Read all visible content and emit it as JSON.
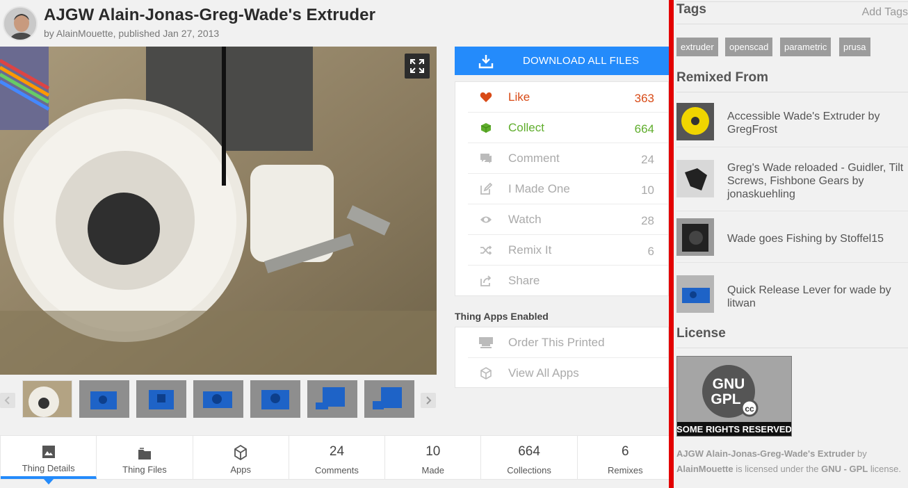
{
  "header": {
    "title": "AJGW Alain-Jonas-Greg-Wade's Extruder",
    "byline": "by AlainMouette, published Jan 27, 2013"
  },
  "download": {
    "label": "DOWNLOAD ALL FILES"
  },
  "actions": [
    {
      "label": "Like",
      "count": "363",
      "icon": "heart-icon",
      "color": "#d84a16"
    },
    {
      "label": "Collect",
      "count": "664",
      "icon": "cube-icon",
      "color": "#5fad2c"
    },
    {
      "label": "Comment",
      "count": "24",
      "icon": "comment-icon"
    },
    {
      "label": "I Made One",
      "count": "10",
      "icon": "pencil-icon"
    },
    {
      "label": "Watch",
      "count": "28",
      "icon": "eye-icon"
    },
    {
      "label": "Remix It",
      "count": "6",
      "icon": "shuffle-icon"
    },
    {
      "label": "Share",
      "count": "",
      "icon": "share-icon"
    }
  ],
  "apps": {
    "heading": "Thing Apps Enabled",
    "items": [
      {
        "label": "Order This Printed",
        "icon": "printer-icon"
      },
      {
        "label": "View All Apps",
        "icon": "box-icon"
      }
    ]
  },
  "tabs": [
    {
      "label": "Thing Details",
      "number": "",
      "icon": "details-icon"
    },
    {
      "label": "Thing Files",
      "number": "",
      "icon": "folder-icon"
    },
    {
      "label": "Apps",
      "number": "",
      "icon": "box-icon"
    },
    {
      "label": "Comments",
      "number": "24"
    },
    {
      "label": "Made",
      "number": "10"
    },
    {
      "label": "Collections",
      "number": "664"
    },
    {
      "label": "Remixes",
      "number": "6"
    }
  ],
  "right": {
    "tags_heading": "Tags",
    "add_tags": "Add Tags",
    "tags": [
      "extruder",
      "openscad",
      "parametric",
      "prusa"
    ],
    "remixed_heading": "Remixed From",
    "remixes": [
      {
        "text": "Accessible Wade's Extruder by GregFrost"
      },
      {
        "text": "Greg's Wade reloaded - Guidler, Tilt Screws, Fishbone Gears by jonaskuehling"
      },
      {
        "text": "Wade goes Fishing by Stoffel15"
      },
      {
        "text": "Quick Release Lever for wade by litwan"
      }
    ],
    "license_heading": "License",
    "license_badge": {
      "line1": "GNU",
      "line2": "GPL",
      "cc": "cc",
      "footer": "SOME RIGHTS RESERVED"
    },
    "license_text": {
      "thing": "AJGW Alain-Jonas-Greg-Wade's Extruder",
      "by": " by ",
      "author": "AlainMouette",
      "mid": " is licensed under the ",
      "license": "GNU - GPL",
      "end": " license."
    }
  }
}
